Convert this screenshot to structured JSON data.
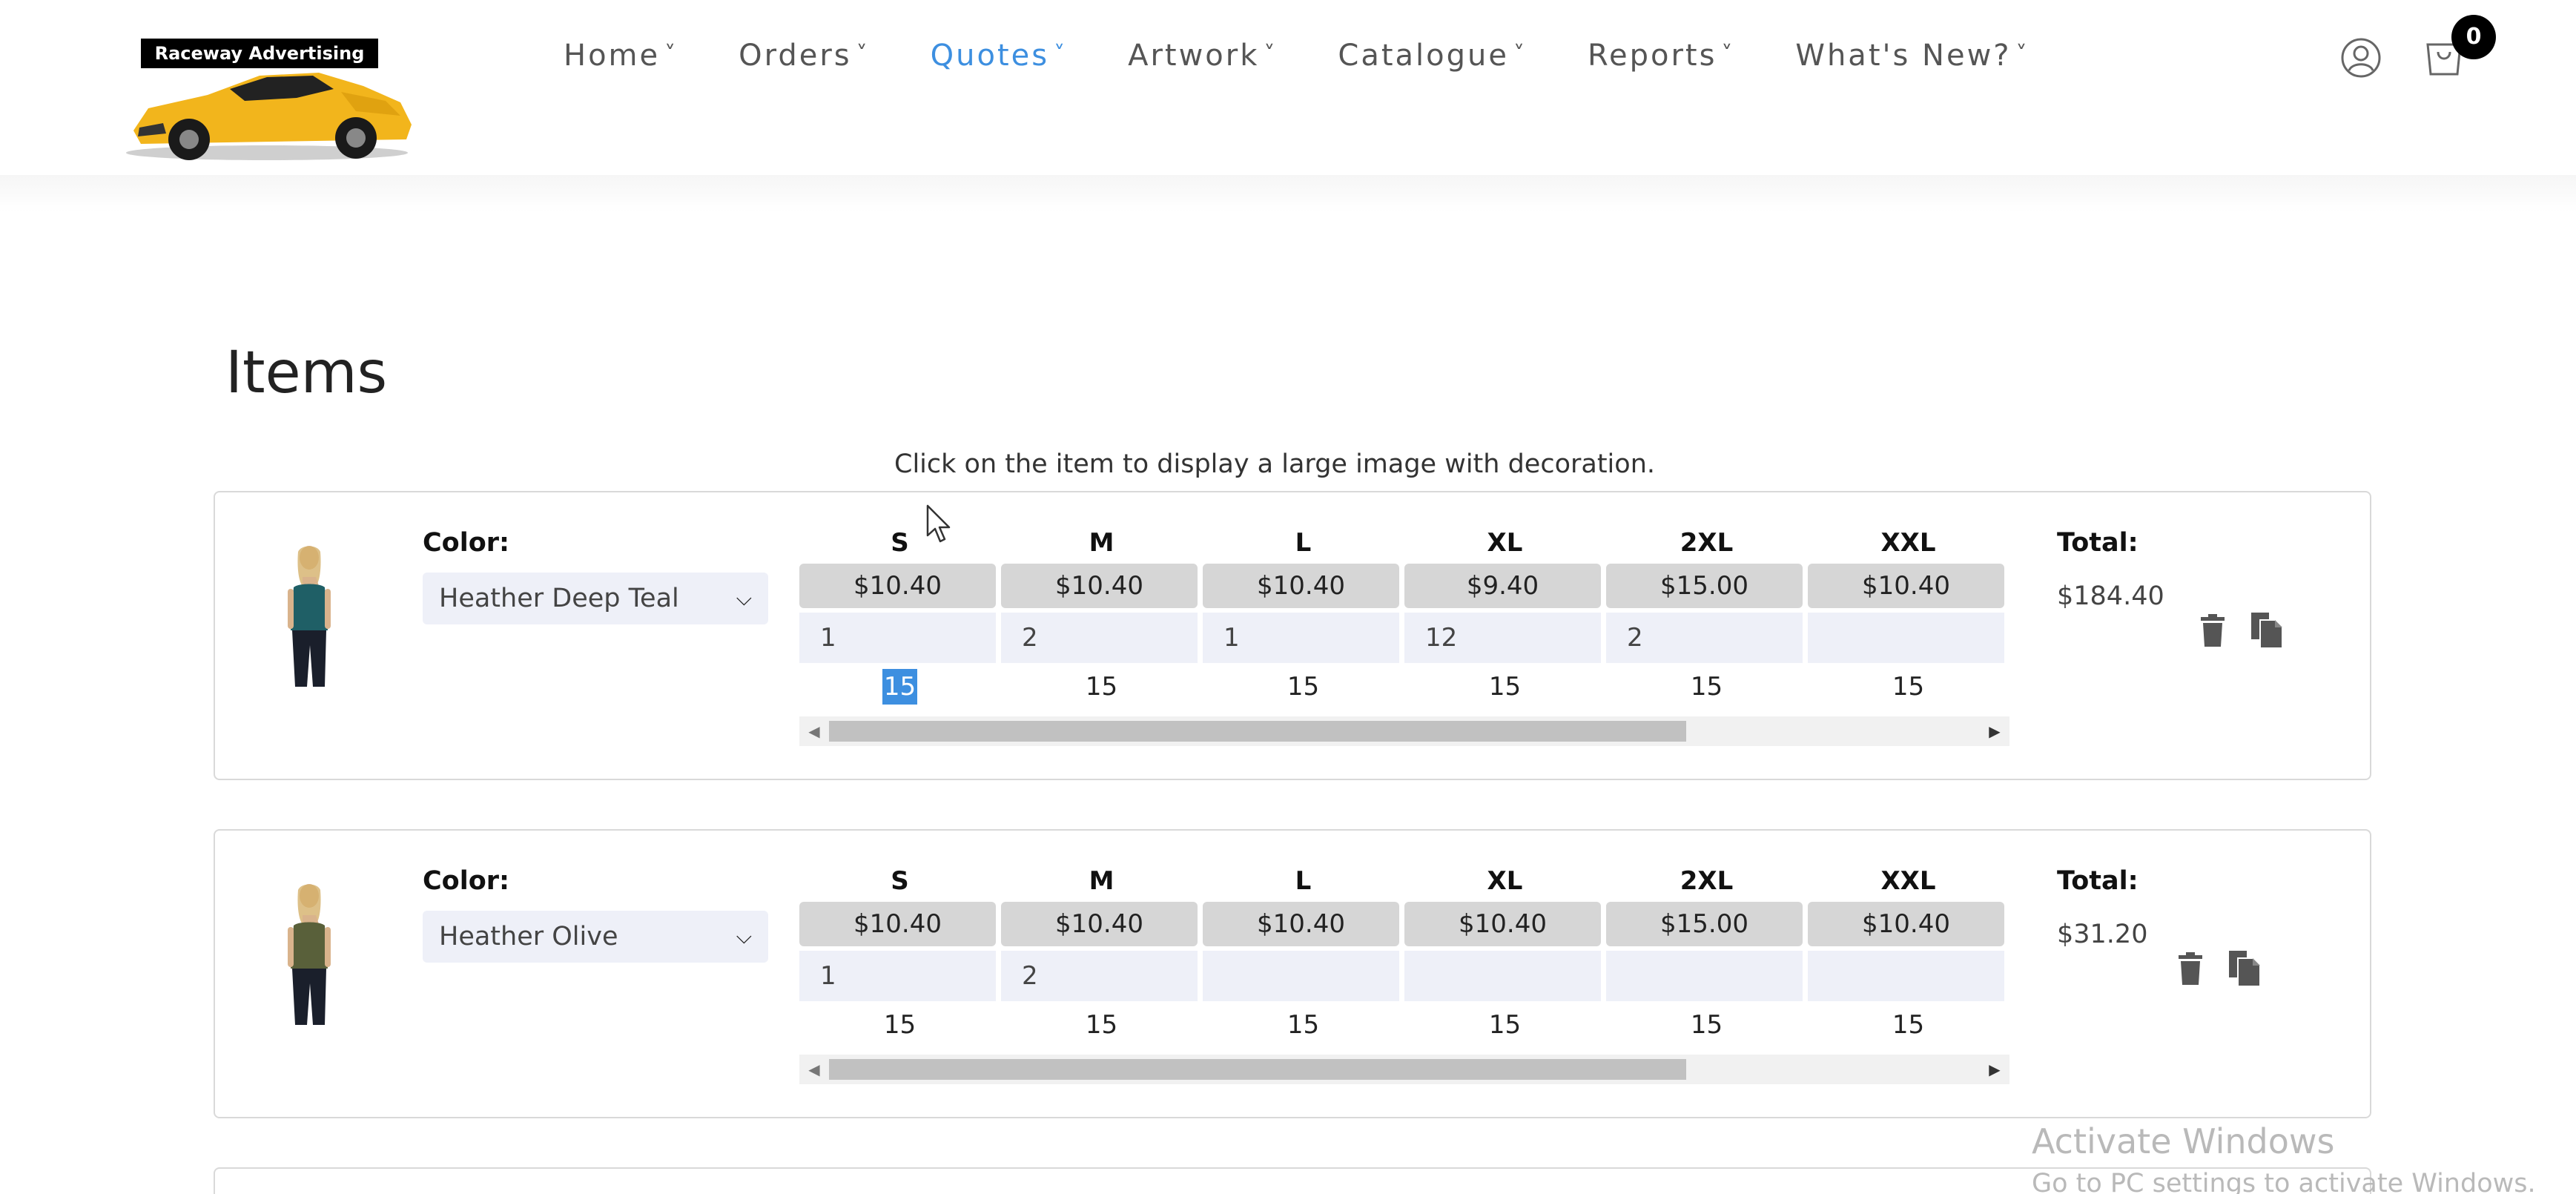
{
  "header": {
    "logo_text": "Raceway Advertising",
    "nav": [
      {
        "label": "Home",
        "active": false
      },
      {
        "label": "Orders",
        "active": false
      },
      {
        "label": "Quotes",
        "active": true
      },
      {
        "label": "Artwork",
        "active": false
      },
      {
        "label": "Catalogue",
        "active": false
      },
      {
        "label": "Reports",
        "active": false
      },
      {
        "label": "What's New?",
        "active": false
      }
    ],
    "chevron": "˅",
    "cart_count": "0",
    "icons": {
      "user": "user-circle-icon",
      "cart": "shopping-bag-icon"
    }
  },
  "page": {
    "title": "Items",
    "hint": "Click on the item to display a large image with decoration."
  },
  "items": [
    {
      "color_label": "Color:",
      "color_value": "Heather Deep Teal",
      "shirt_color": "#1f5f66",
      "sizes": [
        "S",
        "M",
        "L",
        "XL",
        "2XL",
        "XXL"
      ],
      "prices": [
        "$10.40",
        "$10.40",
        "$10.40",
        "$9.40",
        "$15.00",
        "$10.40"
      ],
      "quantities": [
        "1",
        "2",
        "1",
        "12",
        "2",
        ""
      ],
      "minimums": [
        "15",
        "15",
        "15",
        "15",
        "15",
        "15"
      ],
      "selected_minimum_index": 0,
      "total_label": "Total:",
      "total_value": "$184.40"
    },
    {
      "color_label": "Color:",
      "color_value": "Heather Olive",
      "shirt_color": "#59603a",
      "sizes": [
        "S",
        "M",
        "L",
        "XL",
        "2XL",
        "XXL"
      ],
      "prices": [
        "$10.40",
        "$10.40",
        "$10.40",
        "$10.40",
        "$15.00",
        "$10.40"
      ],
      "quantities": [
        "1",
        "2",
        "",
        "",
        "",
        ""
      ],
      "minimums": [
        "15",
        "15",
        "15",
        "15",
        "15",
        "15"
      ],
      "selected_minimum_index": -1,
      "total_label": "Total:",
      "total_value": "$31.20"
    }
  ],
  "watermark": {
    "line1": "Activate Windows",
    "line2": "Go to PC settings to activate Windows."
  },
  "colors": {
    "accent": "#3d8fe0",
    "logo_car": "#f2b51c"
  }
}
